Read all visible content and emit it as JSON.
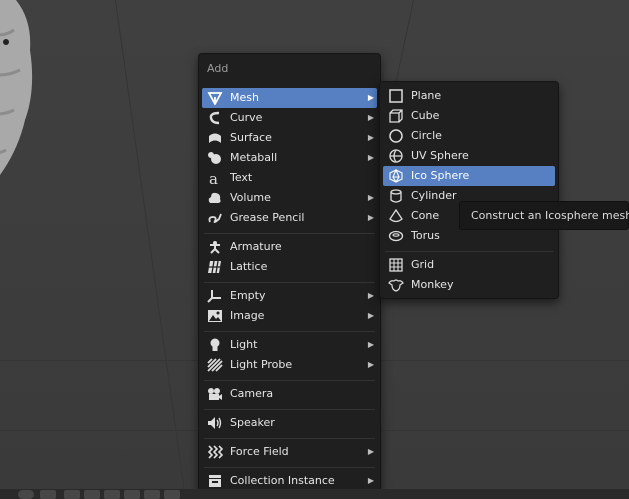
{
  "add_menu": {
    "title": "Add",
    "items": [
      {
        "label": "Mesh",
        "icon": "mesh-icon",
        "submenu": true,
        "highlighted": true
      },
      {
        "label": "Curve",
        "icon": "curve-icon",
        "submenu": true
      },
      {
        "label": "Surface",
        "icon": "surface-icon",
        "submenu": true
      },
      {
        "label": "Metaball",
        "icon": "metaball-icon",
        "submenu": true
      },
      {
        "label": "Text",
        "icon": "text-icon",
        "submenu": false
      },
      {
        "label": "Volume",
        "icon": "volume-icon",
        "submenu": true
      },
      {
        "label": "Grease Pencil",
        "icon": "grease-pencil-icon",
        "submenu": true
      },
      {
        "label": "Armature",
        "icon": "armature-icon",
        "submenu": false
      },
      {
        "label": "Lattice",
        "icon": "lattice-icon",
        "submenu": false
      },
      {
        "label": "Empty",
        "icon": "empty-icon",
        "submenu": true
      },
      {
        "label": "Image",
        "icon": "image-icon",
        "submenu": true
      },
      {
        "label": "Light",
        "icon": "light-icon",
        "submenu": true
      },
      {
        "label": "Light Probe",
        "icon": "light-probe-icon",
        "submenu": true
      },
      {
        "label": "Camera",
        "icon": "camera-icon",
        "submenu": false
      },
      {
        "label": "Speaker",
        "icon": "speaker-icon",
        "submenu": false
      },
      {
        "label": "Force Field",
        "icon": "force-field-icon",
        "submenu": true
      },
      {
        "label": "Collection Instance",
        "icon": "collection-instance-icon",
        "submenu": true
      }
    ]
  },
  "mesh_menu": {
    "items": [
      {
        "label": "Plane",
        "icon": "plane-icon"
      },
      {
        "label": "Cube",
        "icon": "cube-icon"
      },
      {
        "label": "Circle",
        "icon": "circle-icon"
      },
      {
        "label": "UV Sphere",
        "icon": "uv-sphere-icon"
      },
      {
        "label": "Ico Sphere",
        "icon": "ico-sphere-icon",
        "highlighted": true
      },
      {
        "label": "Cylinder",
        "icon": "cylinder-icon"
      },
      {
        "label": "Cone",
        "icon": "cone-icon"
      },
      {
        "label": "Torus",
        "icon": "torus-icon"
      },
      {
        "label": "Grid",
        "icon": "grid-icon"
      },
      {
        "label": "Monkey",
        "icon": "monkey-icon"
      }
    ]
  },
  "tooltip": {
    "text": "Construct an Icosphere mesh."
  },
  "colors": {
    "highlight": "#5680c2",
    "menu_bg": "#1f1f1f",
    "viewport_bg": "#3d3d3d",
    "text": "#e6e6e6"
  }
}
